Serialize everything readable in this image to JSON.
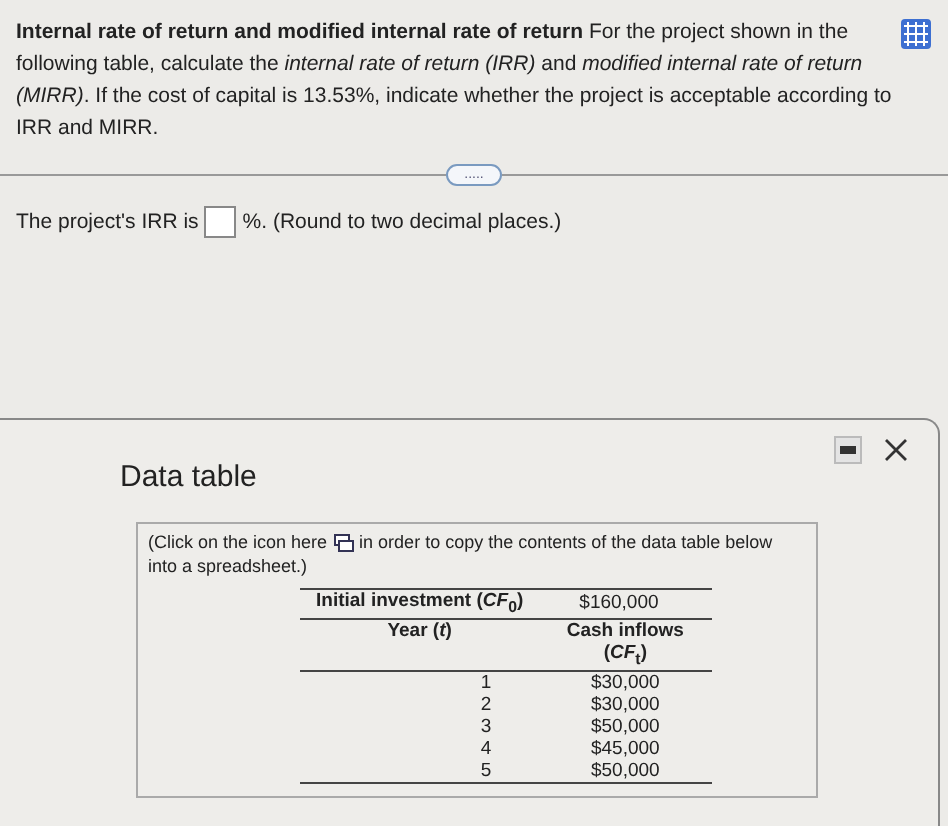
{
  "question": {
    "text": "**Internal rate of return and modified internal rate of return** For the project shown in the following table, calculate the *internal rate of return (IRR)* and *modified internal rate of return (MIRR)*.  If the cost of capital is 13.53%, indicate whether the project is acceptable according to IRR and MIRR."
  },
  "expand_button": ".....",
  "answer": {
    "before": "The project's IRR is",
    "after": "%.  (Round to two decimal places.)"
  },
  "dialog": {
    "title": "Data table",
    "note_before": "(Click on the icon here",
    "note_after": "in order to copy the contents of the data table below",
    "note_end": "into a spreadsheet.)",
    "initial": {
      "label": "Initial investment (*CF*$_{0}$)",
      "value": "$160,000"
    },
    "columns": [
      "Year (*t*)",
      "Cash inflows (*CF*$_{t}$)"
    ],
    "rows": [
      {
        "year": "1",
        "inflow": "$30,000"
      },
      {
        "year": "2",
        "inflow": "$30,000"
      },
      {
        "year": "3",
        "inflow": "$50,000"
      },
      {
        "year": "4",
        "inflow": "$45,000"
      },
      {
        "year": "5",
        "inflow": "$50,000"
      }
    ]
  }
}
